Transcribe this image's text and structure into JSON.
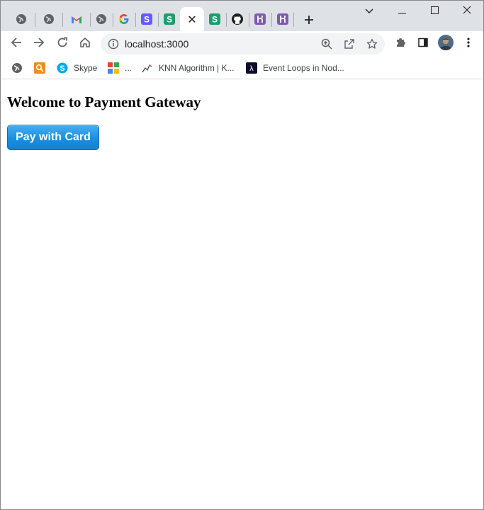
{
  "browser": {
    "tabs": [
      {
        "icon": "globe-icon"
      },
      {
        "icon": "globe-icon"
      },
      {
        "icon": "gmail-icon"
      },
      {
        "icon": "globe-icon"
      },
      {
        "icon": "google-icon",
        "letter": "G"
      },
      {
        "icon": "stripe-purple-icon",
        "letter": "S"
      },
      {
        "icon": "stripe-green-icon",
        "letter": "S"
      },
      {
        "icon": "close-icon",
        "active": true
      },
      {
        "icon": "stripe-green-icon",
        "letter": "S"
      },
      {
        "icon": "github-icon"
      },
      {
        "icon": "heroku-icon",
        "letter": "H"
      },
      {
        "icon": "heroku-icon",
        "letter": "H"
      }
    ],
    "address_bar": {
      "url": "localhost:3000"
    },
    "bookmarks": [
      {
        "icon": "globe-icon",
        "label": ""
      },
      {
        "icon": "orange-search-icon",
        "label": ""
      },
      {
        "icon": "skype-icon",
        "label": "Skype"
      },
      {
        "icon": "google-grid-icon",
        "label": "..."
      },
      {
        "icon": "chart-trend-icon",
        "label": "KNN Algorithm | K..."
      },
      {
        "icon": "lambda-icon",
        "label": "Event Loops in Nod..."
      }
    ],
    "colors": {
      "tabstrip": "#dee1e6",
      "stripe_purple": "#635bff",
      "stripe_green": "#1f9e6c",
      "heroku": "#7e5ab0",
      "gmail_red": "#ea4335"
    }
  },
  "page": {
    "heading": "Welcome to Payment Gateway",
    "pay_button_label": "Pay with Card",
    "pay_button_color": "#1a8fe0"
  }
}
